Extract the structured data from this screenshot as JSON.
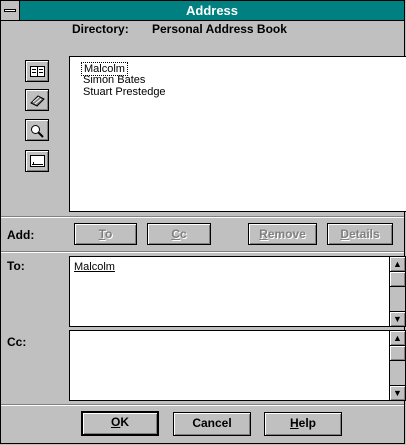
{
  "window": {
    "title": "Address"
  },
  "directory": {
    "label": "Directory:",
    "name": "Personal Address Book"
  },
  "list": {
    "items": [
      "Malcolm",
      "Simon Bates",
      "Stuart Prestedge"
    ]
  },
  "tools": [
    "address-book-icon",
    "directory-icon",
    "search-icon",
    "new-entry-icon"
  ],
  "add_row": {
    "label": "Add:",
    "to_mnemonic": "T",
    "to_rest": "o",
    "cc_mnemonic": "C",
    "cc_rest": "c",
    "remove_mnemonic": "R",
    "remove_rest": "emove",
    "details_mnemonic": "D",
    "details_rest": "etails"
  },
  "to_field": {
    "label": "To:",
    "value": "Malcolm"
  },
  "cc_field": {
    "label": "Cc:",
    "value": ""
  },
  "buttons": {
    "ok_mnemonic": "O",
    "ok_rest": "K",
    "cancel": "Cancel",
    "help_mnemonic": "H",
    "help_rest": "elp"
  },
  "colors": {
    "title_bar": "#008080",
    "face": "#c0c0c0",
    "disabled_text": "#808080"
  }
}
